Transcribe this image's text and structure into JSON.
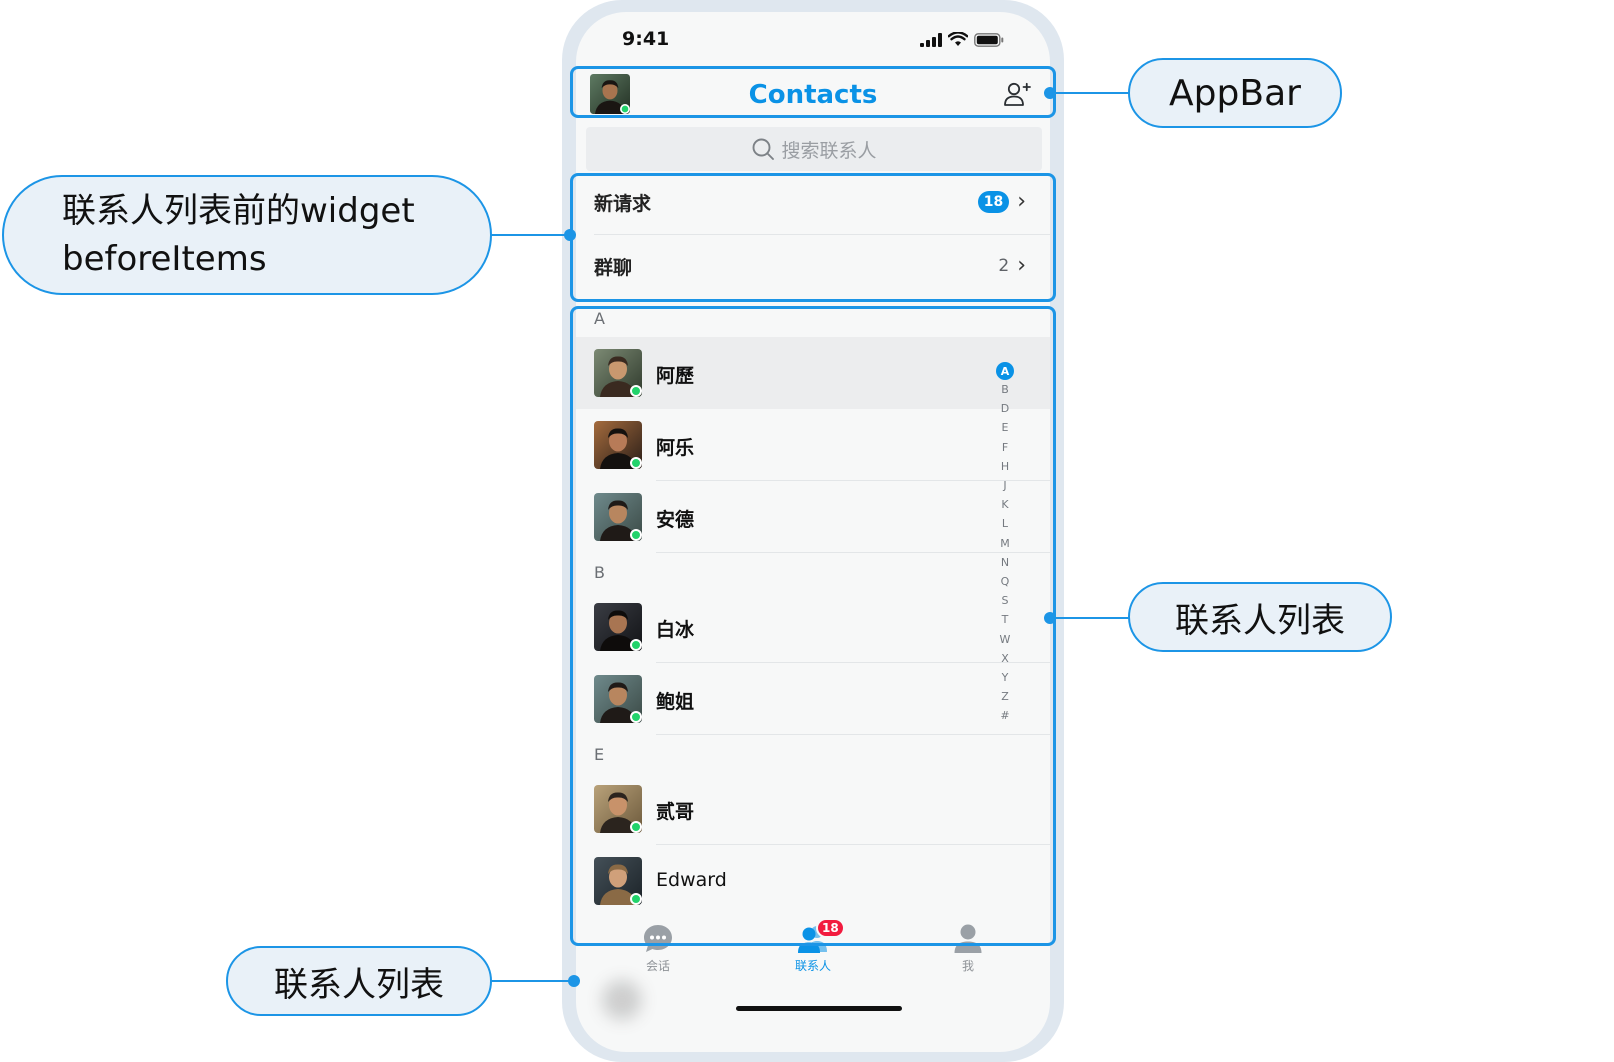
{
  "status_bar": {
    "time": "9:41"
  },
  "appbar": {
    "title": "Contacts"
  },
  "search": {
    "placeholder": "搜索联系人"
  },
  "before_items": [
    {
      "label": "新请求",
      "badge": "18",
      "count": null
    },
    {
      "label": "群聊",
      "badge": null,
      "count": "2"
    }
  ],
  "contact_sections": [
    {
      "letter": "A",
      "contacts": [
        "阿歷",
        "阿乐",
        "安德"
      ]
    },
    {
      "letter": "B",
      "contacts": [
        "白冰",
        "鲍姐"
      ]
    },
    {
      "letter": "E",
      "contacts": [
        "贰哥",
        "Edward"
      ]
    }
  ],
  "alpha_index": {
    "letters": [
      "A",
      "B",
      "D",
      "E",
      "F",
      "H",
      "J",
      "K",
      "L",
      "M",
      "N",
      "Q",
      "S",
      "T",
      "W",
      "X",
      "Y",
      "Z",
      "#"
    ],
    "active": "A"
  },
  "bottom_nav": [
    {
      "label": "会话",
      "icon": "chat-bubble-icon",
      "active": false,
      "badge": null
    },
    {
      "label": "联系人",
      "icon": "contacts-icon",
      "active": true,
      "badge": "18"
    },
    {
      "label": "我",
      "icon": "person-icon",
      "active": false,
      "badge": null
    }
  ],
  "callouts": {
    "appbar": "AppBar",
    "before_items_line1": "联系人列表前的widget",
    "before_items_line2": "beforeItems",
    "contact_list": "联系人列表",
    "bottom": "联系人列表"
  },
  "colors": {
    "accent": "#0a92e6",
    "callout_border": "#1c95e6",
    "callout_fill": "#e9f1f8",
    "badge_red": "#f21b3f",
    "online": "#22d36b"
  }
}
